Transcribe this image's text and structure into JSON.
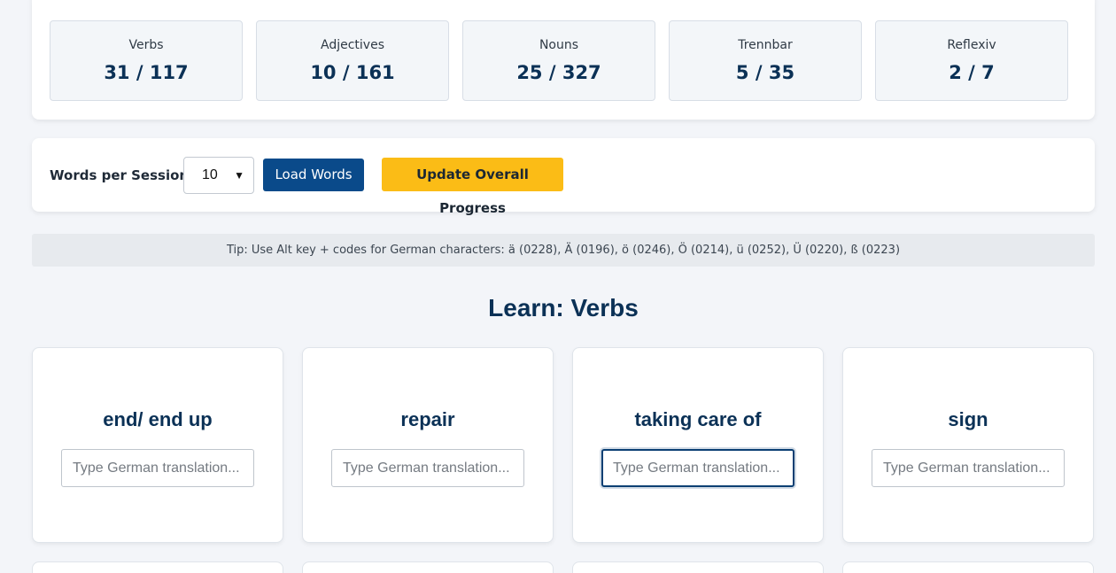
{
  "stats": [
    {
      "label": "Verbs",
      "value": "31 / 117"
    },
    {
      "label": "Adjectives",
      "value": "10 / 161"
    },
    {
      "label": "Nouns",
      "value": "25 / 327"
    },
    {
      "label": "Trennbar",
      "value": "5 / 35"
    },
    {
      "label": "Reflexiv",
      "value": "2 / 7"
    }
  ],
  "controls": {
    "words_per_session_label": "Words per Session:",
    "words_per_session_value": "10",
    "load_button": "Load Words",
    "update_button": "Update Overall Progress"
  },
  "tip": "Tip: Use Alt key + codes for German characters: ä (0228), Ä (0196), ö (0246), Ö (0214), ü (0252), Ü (0220), ß (0223)",
  "section_title": "Learn: Verbs",
  "input_placeholder": "Type German translation...",
  "cards": [
    {
      "word": "end/ end up"
    },
    {
      "word": "repair"
    },
    {
      "word": "taking care of"
    },
    {
      "word": "sign"
    }
  ],
  "colors": {
    "primary": "#0a4a8a",
    "accent": "#fbbc16",
    "heading": "#0b3156",
    "background": "#f3f5f9"
  }
}
